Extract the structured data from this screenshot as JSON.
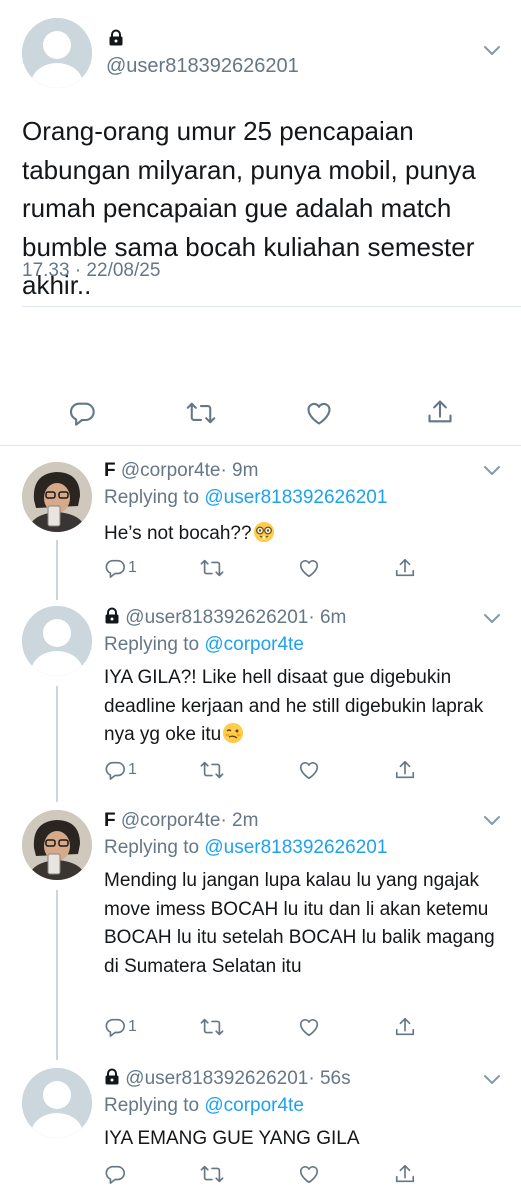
{
  "main_tweet": {
    "handle": "@user818392626201",
    "text": "Orang-orang umur 25 pencapaian tabungan milyaran, punya mobil, punya rumah pencapaian gue adalah match bumble sama bocah kuliahan semester akhir..",
    "timestamp": "17.33 · 22/08/25"
  },
  "replies": [
    {
      "name": "F",
      "handle": "@corpor4te",
      "time": "· 9m",
      "replying_label": "Replying to",
      "replying_to": "@user818392626201",
      "text": "He’s not bocah??",
      "emoji": "nerd-face-emoji",
      "reply_count": "1"
    },
    {
      "name": "",
      "handle": "@user818392626201",
      "time": "· 6m",
      "replying_label": "Replying to",
      "replying_to": "@corpor4te",
      "text": "IYA GILA?! Like hell disaat gue digebukin deadline kerjaan and he still digebukin laprak nya yg oke itu",
      "emoji": "woozy-face-emoji",
      "reply_count": "1"
    },
    {
      "name": "F",
      "handle": "@corpor4te",
      "time": "· 2m",
      "replying_label": "Replying to",
      "replying_to": "@user818392626201",
      "text": "Mending lu jangan lupa kalau lu yang ngajak move imess BOCAH lu itu dan li akan ketemu BOCAH lu itu setelah BOCAH lu balik magang di Sumatera Selatan itu",
      "reply_count": "1"
    },
    {
      "name": "",
      "handle": "@user818392626201",
      "time": "· 56s",
      "replying_label": "Replying to",
      "replying_to": "@corpor4te",
      "text": "IYA EMANG GUE YANG GILA",
      "reply_count": ""
    }
  ],
  "colors": {
    "link": "#1da1f2",
    "secondary": "#657786",
    "divider": "#e1e8ed"
  }
}
